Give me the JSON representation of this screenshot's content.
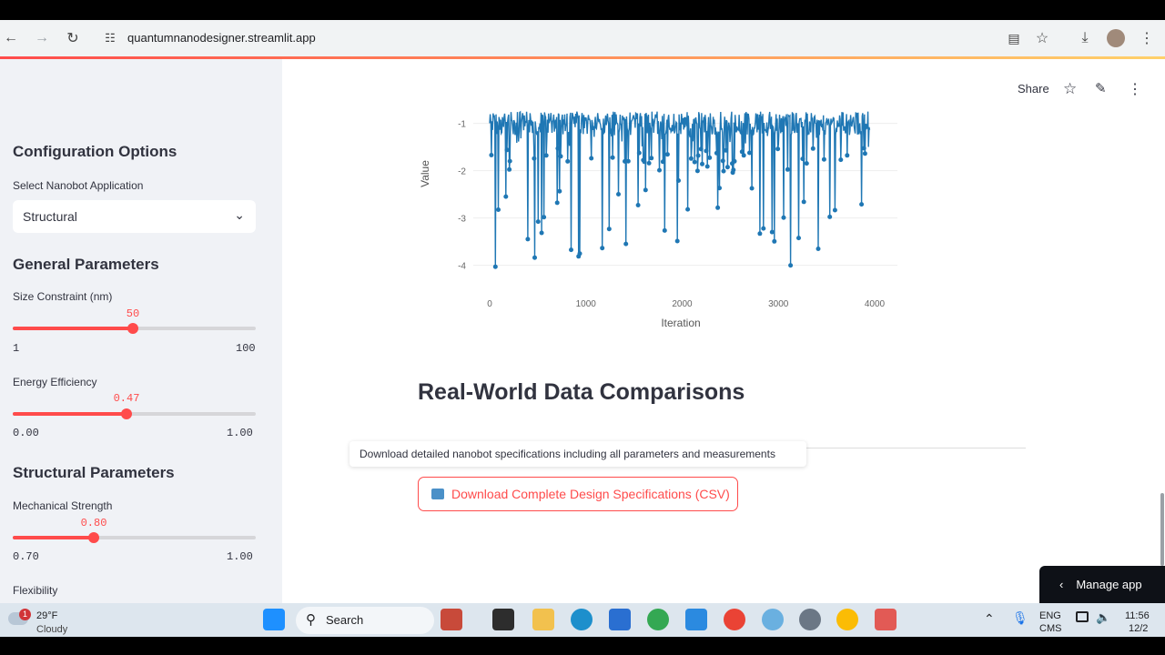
{
  "browser": {
    "url": "quantumnanodesigner.streamlit.app"
  },
  "sidebar": {
    "config_title": "Configuration Options",
    "app_select_label": "Select Nanobot Application",
    "app_select_value": "Structural",
    "general_title": "General Parameters",
    "size": {
      "label": "Size Constraint (nm)",
      "value": "50",
      "min": "1",
      "max": "100",
      "fraction": 0.495
    },
    "energy": {
      "label": "Energy Efficiency",
      "value": "0.47",
      "min": "0.00",
      "max": "1.00",
      "fraction": 0.47
    },
    "structural_title": "Structural Parameters",
    "mech": {
      "label": "Mechanical Strength",
      "value": "0.80",
      "min": "0.70",
      "max": "1.00",
      "fraction": 0.333
    },
    "flex_label": "Flexibility"
  },
  "toolbar": {
    "share": "Share"
  },
  "chart_data": {
    "type": "line",
    "xlabel": "Iteration",
    "ylabel": "Value",
    "xlim": [
      0,
      4000
    ],
    "ylim": [
      -4.2,
      -0.7
    ],
    "x_ticks": [
      "0",
      "1000",
      "2000",
      "3000",
      "4000"
    ],
    "y_ticks": [
      "-1",
      "-2",
      "-3",
      "-4"
    ],
    "color": "#1f77b4"
  },
  "main": {
    "section_title": "Real-World Data Comparisons",
    "tooltip": "Download detailed nanobot specifications including all parameters and measurements",
    "download_label": "Download Complete Design Specifications (CSV)",
    "manage_app": "Manage app"
  },
  "taskbar": {
    "temp": "29°F",
    "weather": "Cloudy",
    "search": "Search",
    "lang1": "ENG",
    "lang2": "CMS",
    "time": "11:56",
    "date": "12/2",
    "badge": "1"
  },
  "colors": {
    "accent": "#ff4b4b",
    "sidebar_bg": "#f0f2f6",
    "text": "#31333f"
  }
}
